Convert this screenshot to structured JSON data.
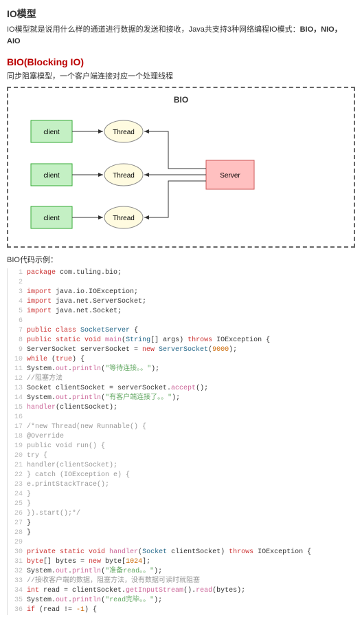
{
  "h1": "IO模型",
  "intro_a": "IO模型就是说用什么样的通道进行数据的发送和接收，Java共支持3种网络编程IO模式：",
  "intro_b": "BIO，NIO，AIO",
  "h2": "BIO(Blocking IO)",
  "sub": "同步阻塞模型，一个客户端连接对应一个处理线程",
  "diagram_title": "BIO",
  "client": "client",
  "thread": "Thread",
  "server": "Server",
  "codetitle": "BIO代码示例：",
  "code": [
    {
      "n": 1,
      "t": [
        "package",
        " com.tuling.bio",
        ";"
      ],
      "cls": [
        "kw",
        "",
        "p"
      ]
    },
    {
      "n": 2,
      "t": [
        ""
      ],
      "cls": [
        ""
      ]
    },
    {
      "n": 3,
      "t": [
        "import",
        " java.io.IOException",
        ";"
      ],
      "cls": [
        "kw",
        "",
        "p"
      ]
    },
    {
      "n": 4,
      "t": [
        "import",
        " java.net.ServerSocket",
        ";"
      ],
      "cls": [
        "kw",
        "",
        "p"
      ]
    },
    {
      "n": 5,
      "t": [
        "import",
        " java.net.Socket",
        ";"
      ],
      "cls": [
        "kw",
        "",
        "p"
      ]
    },
    {
      "n": 6,
      "t": [
        ""
      ],
      "cls": [
        ""
      ]
    },
    {
      "n": 7,
      "t": [
        "public class ",
        "SocketServer",
        " {"
      ],
      "cls": [
        "kw",
        "cls",
        ""
      ]
    },
    {
      "n": 8,
      "t": [
        " public static void ",
        "main",
        "(",
        "String",
        "[] args) ",
        "throws",
        " IOException {"
      ],
      "cls": [
        "kw",
        "mtd",
        "",
        "cls",
        "",
        "kw",
        ""
      ]
    },
    {
      "n": 9,
      "t": [
        "  ServerSocket serverSocket = ",
        "new",
        " ServerSocket",
        "(",
        "9000",
        ");"
      ],
      "cls": [
        "",
        "kw",
        "cls",
        "",
        "num",
        ""
      ]
    },
    {
      "n": 10,
      "t": [
        "  while",
        " (",
        "true",
        ") {"
      ],
      "cls": [
        "kw",
        "",
        "kw",
        ""
      ]
    },
    {
      "n": 11,
      "t": [
        "   System.",
        "out",
        ".",
        "println",
        "(",
        "\"等待连接。。\"",
        ");"
      ],
      "cls": [
        "",
        "mtd",
        "",
        "mtd",
        "",
        "str",
        ""
      ]
    },
    {
      "n": 12,
      "t": [
        "   //阻塞方法"
      ],
      "cls": [
        "cmt"
      ]
    },
    {
      "n": 13,
      "t": [
        "   Socket clientSocket = serverSocket.",
        "accept",
        "();"
      ],
      "cls": [
        "",
        "mtd",
        ""
      ]
    },
    {
      "n": 14,
      "t": [
        "   System.",
        "out",
        ".",
        "println",
        "(",
        "\"有客户端连接了。。\"",
        ");"
      ],
      "cls": [
        "",
        "mtd",
        "",
        "mtd",
        "",
        "str",
        ""
      ]
    },
    {
      "n": 15,
      "t": [
        "   ",
        "handler",
        "(clientSocket);"
      ],
      "cls": [
        "",
        "mtd",
        ""
      ]
    },
    {
      "n": 16,
      "t": [
        ""
      ],
      "cls": [
        ""
      ]
    },
    {
      "n": 17,
      "t": [
        "   /*new Thread(new Runnable() {"
      ],
      "cls": [
        "cmt"
      ]
    },
    {
      "n": 18,
      "t": [
        "    @Override"
      ],
      "cls": [
        "cmt"
      ]
    },
    {
      "n": 19,
      "t": [
        "    public void run() {"
      ],
      "cls": [
        "cmt"
      ]
    },
    {
      "n": 20,
      "t": [
        "    try {"
      ],
      "cls": [
        "cmt"
      ]
    },
    {
      "n": 21,
      "t": [
        "    handler(clientSocket);"
      ],
      "cls": [
        "cmt"
      ]
    },
    {
      "n": 22,
      "t": [
        "    } catch (IOException e) {"
      ],
      "cls": [
        "cmt"
      ]
    },
    {
      "n": 23,
      "t": [
        "    e.printStackTrace();"
      ],
      "cls": [
        "cmt"
      ]
    },
    {
      "n": 24,
      "t": [
        "    }"
      ],
      "cls": [
        "cmt"
      ]
    },
    {
      "n": 25,
      "t": [
        "    }"
      ],
      "cls": [
        "cmt"
      ]
    },
    {
      "n": 26,
      "t": [
        "    }).start();*/"
      ],
      "cls": [
        "cmt"
      ]
    },
    {
      "n": 27,
      "t": [
        "   }"
      ],
      "cls": [
        ""
      ]
    },
    {
      "n": 28,
      "t": [
        "  }"
      ],
      "cls": [
        ""
      ]
    },
    {
      "n": 29,
      "t": [
        ""
      ],
      "cls": [
        ""
      ]
    },
    {
      "n": 30,
      "t": [
        " private static void ",
        "handler",
        "(",
        "Socket",
        " clientSocket) ",
        "throws",
        " IOException {"
      ],
      "cls": [
        "kw",
        "mtd",
        "",
        "cls",
        "",
        "kw",
        ""
      ]
    },
    {
      "n": 31,
      "t": [
        "  byte",
        "[] bytes = ",
        "new",
        " byte[",
        "1024",
        "];"
      ],
      "cls": [
        "kw",
        "",
        "kw",
        "",
        "num",
        ""
      ]
    },
    {
      "n": 32,
      "t": [
        "  System.",
        "out",
        ".",
        "println",
        "(",
        "\"准备read。。\"",
        ");"
      ],
      "cls": [
        "",
        "mtd",
        "",
        "mtd",
        "",
        "str",
        ""
      ]
    },
    {
      "n": 33,
      "t": [
        "  //接收客户端的数据，阻塞方法，没有数据可读时就阻塞"
      ],
      "cls": [
        "cmt"
      ]
    },
    {
      "n": 34,
      "t": [
        "  int",
        " read = clientSocket.",
        "getInputStream",
        "().",
        "read",
        "(bytes);"
      ],
      "cls": [
        "kw",
        "",
        "mtd",
        "",
        "mtd",
        ""
      ]
    },
    {
      "n": 35,
      "t": [
        "  System.",
        "out",
        ".",
        "println",
        "(",
        "\"read完毕。。\"",
        ");"
      ],
      "cls": [
        "",
        "mtd",
        "",
        "mtd",
        "",
        "str",
        ""
      ]
    },
    {
      "n": 36,
      "t": [
        "  if",
        " (read != ",
        "-1",
        ") {"
      ],
      "cls": [
        "kw",
        "",
        "num",
        ""
      ]
    }
  ]
}
